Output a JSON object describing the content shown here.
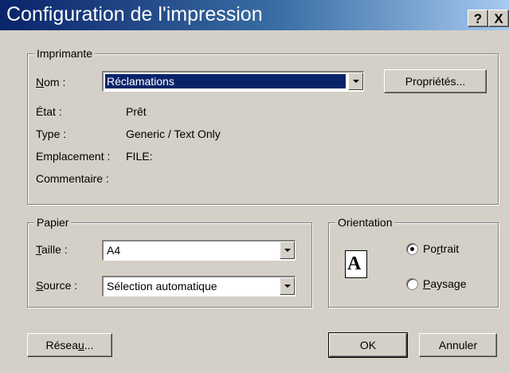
{
  "window": {
    "title": "Configuration de l'impression",
    "help_button": "?",
    "close_button": "X"
  },
  "printer": {
    "group_label": "Imprimante",
    "name_label": "Nom :",
    "name_value": "Réclamations",
    "properties_button": "Propriétés...",
    "status_label": "État :",
    "status_value": "Prêt",
    "type_label": "Type :",
    "type_value": "Generic / Text Only",
    "location_label": "Emplacement :",
    "location_value": "FILE:",
    "comment_label": "Commentaire :",
    "comment_value": ""
  },
  "paper": {
    "group_label": "Papier",
    "size_label": "Taille :",
    "size_value": "A4",
    "source_label": "Source :",
    "source_value": "Sélection automatique"
  },
  "orientation": {
    "group_label": "Orientation",
    "icon_letter": "A",
    "portrait_label": "Portrait",
    "landscape_label": "Paysage",
    "selected": "Portrait"
  },
  "footer": {
    "network_button": "Réseau...",
    "ok_button": "OK",
    "cancel_button": "Annuler"
  },
  "colors": {
    "title_bar_start": "#0a246a",
    "title_bar_end": "#a6caf0",
    "dialog_face": "#d4d0c8",
    "selection": "#0a246a"
  }
}
